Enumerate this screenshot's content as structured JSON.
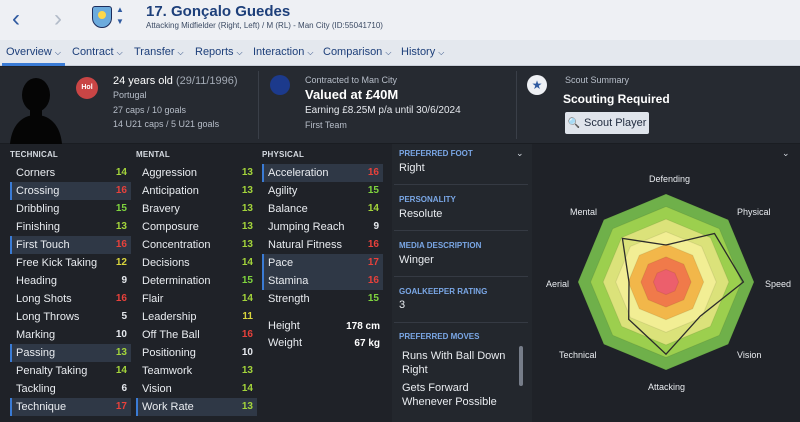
{
  "header": {
    "back_icon": "back-arrow-icon",
    "forward_icon": "forward-arrow-icon",
    "club_crest": "man-city-crest-icon",
    "player_name": "17. Gonçalo Guedes",
    "player_subtitle": "Attacking Midfielder (Right, Left) / M (RL) - Man City (ID:55041710)"
  },
  "tabs": [
    {
      "label": "Overview"
    },
    {
      "label": "Contract"
    },
    {
      "label": "Transfer"
    },
    {
      "label": "Reports"
    },
    {
      "label": "Interaction"
    },
    {
      "label": "Comparison"
    },
    {
      "label": "History"
    }
  ],
  "info": {
    "flag_text": "Hol",
    "age": "24 years old",
    "dob": "(29/11/1996)",
    "nationality": "Portugal",
    "caps": "27 caps / 10 goals",
    "u21_caps": "14 U21 caps / 5 U21 goals",
    "contracted": "Contracted to Man City",
    "valued": "Valued at £40M",
    "earning": "Earning £8.25M p/a until 30/6/2024",
    "squad": "First Team",
    "scout_header": "Scout Summary",
    "scout_title": "Scouting Required",
    "scout_button": "Scout Player"
  },
  "technical": {
    "header": "TECHNICAL",
    "rows": [
      {
        "name": "Corners",
        "value": "14"
      },
      {
        "name": "Crossing",
        "value": "16"
      },
      {
        "name": "Dribbling",
        "value": "15"
      },
      {
        "name": "Finishing",
        "value": "13"
      },
      {
        "name": "First Touch",
        "value": "16"
      },
      {
        "name": "Free Kick Taking",
        "value": "12"
      },
      {
        "name": "Heading",
        "value": "9"
      },
      {
        "name": "Long Shots",
        "value": "16"
      },
      {
        "name": "Long Throws",
        "value": "5"
      },
      {
        "name": "Marking",
        "value": "10"
      },
      {
        "name": "Passing",
        "value": "13"
      },
      {
        "name": "Penalty Taking",
        "value": "14"
      },
      {
        "name": "Tackling",
        "value": "6"
      },
      {
        "name": "Technique",
        "value": "17"
      }
    ]
  },
  "mental": {
    "header": "MENTAL",
    "rows": [
      {
        "name": "Aggression",
        "value": "13"
      },
      {
        "name": "Anticipation",
        "value": "13"
      },
      {
        "name": "Bravery",
        "value": "13"
      },
      {
        "name": "Composure",
        "value": "13"
      },
      {
        "name": "Concentration",
        "value": "13"
      },
      {
        "name": "Decisions",
        "value": "14"
      },
      {
        "name": "Determination",
        "value": "15"
      },
      {
        "name": "Flair",
        "value": "14"
      },
      {
        "name": "Leadership",
        "value": "11"
      },
      {
        "name": "Off The Ball",
        "value": "16"
      },
      {
        "name": "Positioning",
        "value": "10"
      },
      {
        "name": "Teamwork",
        "value": "13"
      },
      {
        "name": "Vision",
        "value": "14"
      },
      {
        "name": "Work Rate",
        "value": "13"
      }
    ]
  },
  "physical": {
    "header": "PHYSICAL",
    "rows": [
      {
        "name": "Acceleration",
        "value": "16"
      },
      {
        "name": "Agility",
        "value": "15"
      },
      {
        "name": "Balance",
        "value": "14"
      },
      {
        "name": "Jumping Reach",
        "value": "9"
      },
      {
        "name": "Natural Fitness",
        "value": "16"
      },
      {
        "name": "Pace",
        "value": "17"
      },
      {
        "name": "Stamina",
        "value": "16"
      },
      {
        "name": "Strength",
        "value": "15"
      }
    ],
    "height_label": "Height",
    "height_value": "178 cm",
    "weight_label": "Weight",
    "weight_value": "67 kg"
  },
  "details": {
    "foot_head": "PREFERRED FOOT",
    "foot": "Right",
    "personality_head": "PERSONALITY",
    "personality": "Resolute",
    "media_head": "MEDIA DESCRIPTION",
    "media": "Winger",
    "gk_head": "GOALKEEPER RATING",
    "gk": "3",
    "moves_head": "PREFERRED MOVES",
    "moves": [
      "Runs With Ball Down Right",
      "Gets Forward Whenever Possible"
    ]
  },
  "radar": {
    "labels": [
      "Defending",
      "Physical",
      "Speed",
      "Vision",
      "Attacking",
      "Technical",
      "Aerial",
      "Mental"
    ],
    "values": [
      0.42,
      0.78,
      0.88,
      0.55,
      0.82,
      0.6,
      0.42,
      0.7
    ],
    "colors": [
      "#6fb04a",
      "#9ccf4e",
      "#dbe27a",
      "#f2ee94",
      "#f2b74a",
      "#f07a4a",
      "#ec5f6c"
    ]
  }
}
